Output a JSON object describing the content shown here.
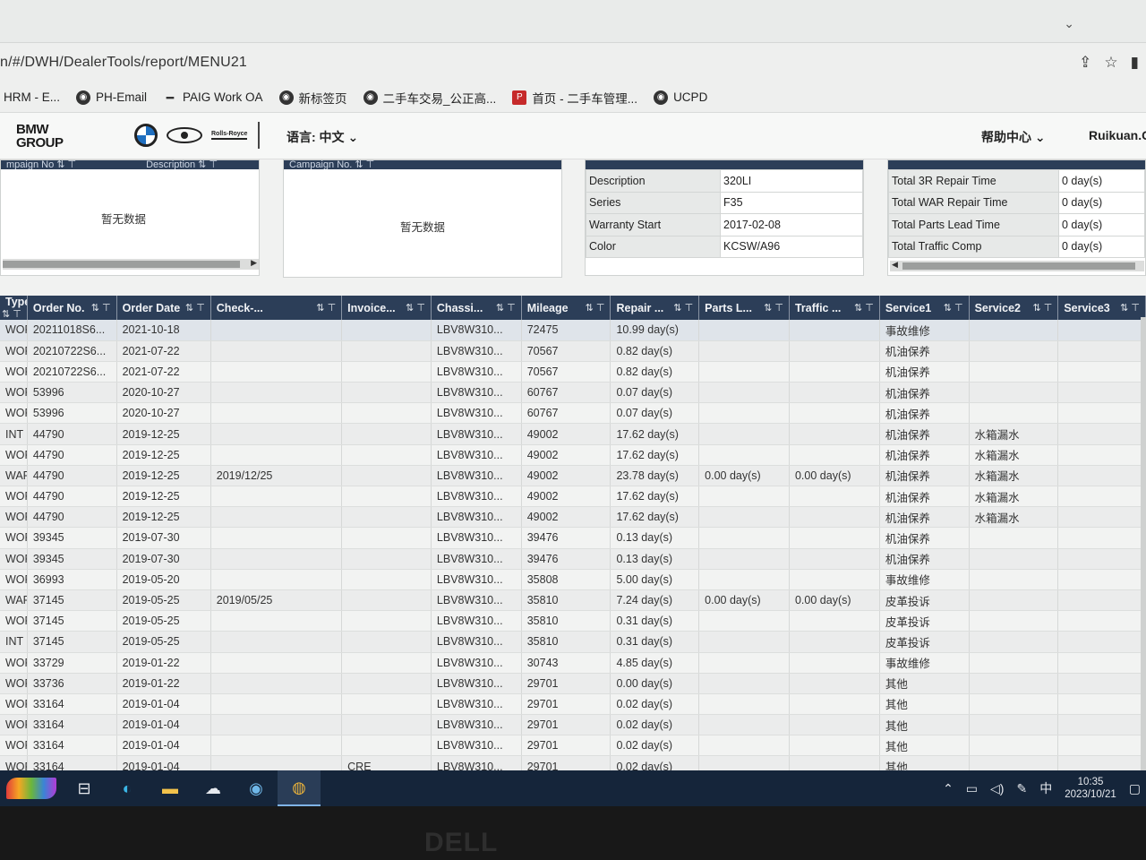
{
  "browser": {
    "url": "n/#/DWH/DealerTools/report/MENU21",
    "actions": [
      "share-icon",
      "star-icon",
      "sidebar-icon"
    ],
    "bookmarks": [
      {
        "icon": "bookmark-icon",
        "label": "HRM - E..."
      },
      {
        "icon": "globe-icon",
        "label": "PH-Email"
      },
      {
        "icon": "dash-icon",
        "label": "PAIG Work OA"
      },
      {
        "icon": "globe-icon",
        "label": "新标签页"
      },
      {
        "icon": "globe-icon",
        "label": "二手车交易_公正高..."
      },
      {
        "icon": "p-icon",
        "label": "首页 - 二手车管理..."
      },
      {
        "icon": "globe-icon",
        "label": "UCPD"
      }
    ]
  },
  "app_header": {
    "logo": "BMW GROUP",
    "brand_rr": "Rolls-Royce",
    "language": "语言: 中文",
    "help": "帮助中心",
    "user": "Ruikuan.C"
  },
  "panels": {
    "p1": {
      "headers": [
        "mpaign No ⇅ ⊤",
        "Description ⇅ ⊤"
      ],
      "empty": "暂无数据"
    },
    "p2": {
      "headers": [
        "Campaign No. ⇅ ⊤"
      ],
      "empty": "暂无数据"
    },
    "vehicle": [
      {
        "k": "Description",
        "v": "320LI"
      },
      {
        "k": "Series",
        "v": "F35"
      },
      {
        "k": "Warranty Start",
        "v": "2017-02-08"
      },
      {
        "k": "Color",
        "v": "KCSW/A96"
      }
    ],
    "totals": [
      {
        "k": "Total 3R Repair Time",
        "v": "0 day(s)"
      },
      {
        "k": "Total WAR Repair Time",
        "v": "0 day(s)"
      },
      {
        "k": "Total Parts Lead Time",
        "v": "0 day(s)"
      },
      {
        "k": "Total Traffic Comp",
        "v": "0 day(s)"
      }
    ]
  },
  "grid": {
    "columns": [
      "Type",
      "Order No.",
      "Order Date",
      "Check-...",
      "Invoice...",
      "Chassi...",
      "Mileage",
      "Repair ...",
      "Parts L...",
      "Traffic ...",
      "Service1",
      "Service2",
      "Service3"
    ],
    "rows": [
      [
        "WOR",
        "20211018S6...",
        "2021-10-18",
        "",
        "",
        "LBV8W310...",
        "72475",
        "10.99 day(s)",
        "",
        "",
        "事故维修",
        "",
        ""
      ],
      [
        "WOR",
        "20210722S6...",
        "2021-07-22",
        "",
        "",
        "LBV8W310...",
        "70567",
        "0.82 day(s)",
        "",
        "",
        "机油保养",
        "",
        ""
      ],
      [
        "WOR",
        "20210722S6...",
        "2021-07-22",
        "",
        "",
        "LBV8W310...",
        "70567",
        "0.82 day(s)",
        "",
        "",
        "机油保养",
        "",
        ""
      ],
      [
        "WOR",
        "53996",
        "2020-10-27",
        "",
        "",
        "LBV8W310...",
        "60767",
        "0.07 day(s)",
        "",
        "",
        "机油保养",
        "",
        ""
      ],
      [
        "WOR",
        "53996",
        "2020-10-27",
        "",
        "",
        "LBV8W310...",
        "60767",
        "0.07 day(s)",
        "",
        "",
        "机油保养",
        "",
        ""
      ],
      [
        "INT",
        "44790",
        "2019-12-25",
        "",
        "",
        "LBV8W310...",
        "49002",
        "17.62 day(s)",
        "",
        "",
        "机油保养",
        "水箱漏水",
        ""
      ],
      [
        "WOR",
        "44790",
        "2019-12-25",
        "",
        "",
        "LBV8W310...",
        "49002",
        "17.62 day(s)",
        "",
        "",
        "机油保养",
        "水箱漏水",
        ""
      ],
      [
        "WAR",
        "44790",
        "2019-12-25",
        "2019/12/25",
        "",
        "LBV8W310...",
        "49002",
        "23.78 day(s)",
        "0.00 day(s)",
        "0.00 day(s)",
        "机油保养",
        "水箱漏水",
        ""
      ],
      [
        "WOR",
        "44790",
        "2019-12-25",
        "",
        "",
        "LBV8W310...",
        "49002",
        "17.62 day(s)",
        "",
        "",
        "机油保养",
        "水箱漏水",
        ""
      ],
      [
        "WOR",
        "44790",
        "2019-12-25",
        "",
        "",
        "LBV8W310...",
        "49002",
        "17.62 day(s)",
        "",
        "",
        "机油保养",
        "水箱漏水",
        ""
      ],
      [
        "WOR",
        "39345",
        "2019-07-30",
        "",
        "",
        "LBV8W310...",
        "39476",
        "0.13 day(s)",
        "",
        "",
        "机油保养",
        "",
        ""
      ],
      [
        "WOR",
        "39345",
        "2019-07-30",
        "",
        "",
        "LBV8W310...",
        "39476",
        "0.13 day(s)",
        "",
        "",
        "机油保养",
        "",
        ""
      ],
      [
        "WOR",
        "36993",
        "2019-05-20",
        "",
        "",
        "LBV8W310...",
        "35808",
        "5.00 day(s)",
        "",
        "",
        "事故维修",
        "",
        ""
      ],
      [
        "WAR",
        "37145",
        "2019-05-25",
        "2019/05/25",
        "",
        "LBV8W310...",
        "35810",
        "7.24 day(s)",
        "0.00 day(s)",
        "0.00 day(s)",
        "皮革投诉",
        "",
        ""
      ],
      [
        "WOR",
        "37145",
        "2019-05-25",
        "",
        "",
        "LBV8W310...",
        "35810",
        "0.31 day(s)",
        "",
        "",
        "皮革投诉",
        "",
        ""
      ],
      [
        "INT",
        "37145",
        "2019-05-25",
        "",
        "",
        "LBV8W310...",
        "35810",
        "0.31 day(s)",
        "",
        "",
        "皮革投诉",
        "",
        ""
      ],
      [
        "WOR",
        "33729",
        "2019-01-22",
        "",
        "",
        "LBV8W310...",
        "30743",
        "4.85 day(s)",
        "",
        "",
        "事故维修",
        "",
        ""
      ],
      [
        "WOR",
        "33736",
        "2019-01-22",
        "",
        "",
        "LBV8W310...",
        "29701",
        "0.00 day(s)",
        "",
        "",
        "其他",
        "",
        ""
      ],
      [
        "WOR",
        "33164",
        "2019-01-04",
        "",
        "",
        "LBV8W310...",
        "29701",
        "0.02 day(s)",
        "",
        "",
        "其他",
        "",
        ""
      ],
      [
        "WOR",
        "33164",
        "2019-01-04",
        "",
        "",
        "LBV8W310...",
        "29701",
        "0.02 day(s)",
        "",
        "",
        "其他",
        "",
        ""
      ],
      [
        "WOR",
        "33164",
        "2019-01-04",
        "",
        "",
        "LBV8W310...",
        "29701",
        "0.02 day(s)",
        "",
        "",
        "其他",
        "",
        ""
      ],
      [
        "WOR",
        "33164",
        "2019-01-04",
        "",
        "CRE",
        "LBV8W310...",
        "29701",
        "0.02 day(s)",
        "",
        "",
        "其他",
        "",
        ""
      ]
    ]
  },
  "taskbar": {
    "apps": [
      "task-view-icon",
      "edge-icon",
      "file-explorer-icon",
      "app-icon",
      "chat-icon",
      "chrome-icon"
    ],
    "ime": "中",
    "time": "10:35",
    "date": "2023/10/21"
  },
  "bezel": {
    "maker": "DELL"
  }
}
